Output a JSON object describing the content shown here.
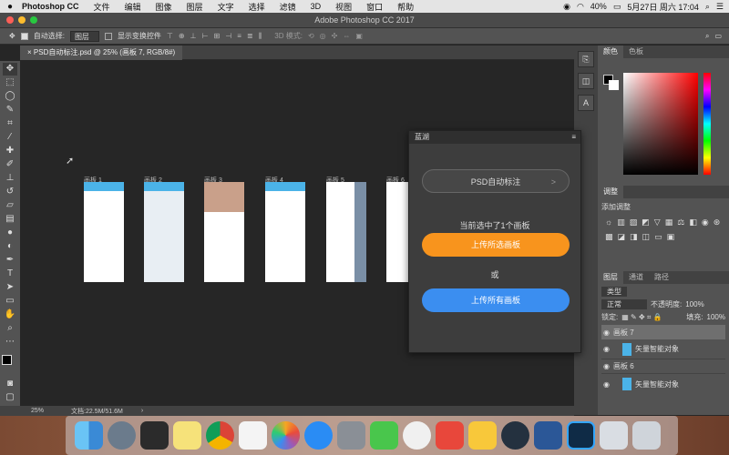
{
  "menubar": {
    "app": "Photoshop CC",
    "items": [
      "文件",
      "编辑",
      "图像",
      "图层",
      "文字",
      "选择",
      "滤镜",
      "3D",
      "视图",
      "窗口",
      "帮助"
    ],
    "battery": "40%",
    "datetime": "5月27日 周六 17:04"
  },
  "window": {
    "title": "Adobe Photoshop CC 2017"
  },
  "options": {
    "auto_select_label": "自动选择:",
    "auto_select_value": "图层",
    "show_transform": "显示变换控件",
    "mode_3d": "3D 模式:"
  },
  "document": {
    "tab": "PSD自动标注.psd @ 25% (画板 7, RGB/8#)"
  },
  "artboards": [
    "画板 1",
    "画板 2",
    "画板 3",
    "画板 4",
    "画板 5",
    "画板 6"
  ],
  "status": {
    "zoom": "25%",
    "doc": "文档:22.5M/51.6M"
  },
  "right_panels": {
    "color_tabs": [
      "颜色",
      "色板"
    ],
    "adjust_title": "调整",
    "adjust_add": "添加调整",
    "layers_tabs": [
      "图层",
      "通道",
      "路径"
    ],
    "kind": "类型",
    "blend": "正常",
    "opacity_label": "不透明度:",
    "opacity": "100%",
    "lock_label": "锁定:",
    "fill_label": "填充:",
    "fill": "100%",
    "layers": [
      "画板 7",
      "矢量智能对象",
      "画板 6",
      "矢量智能对象"
    ]
  },
  "dialog": {
    "title": "蓝湖",
    "psd_button": "PSD自动标注",
    "psd_chevron": ">",
    "selection_text": "当前选中了1个画板",
    "upload_selected": "上传所选画板",
    "or": "或",
    "upload_all": "上传所有画板"
  },
  "colors": {
    "orange": "#f8941d",
    "blue": "#3b8ef0",
    "ps_bg": "#262626"
  }
}
